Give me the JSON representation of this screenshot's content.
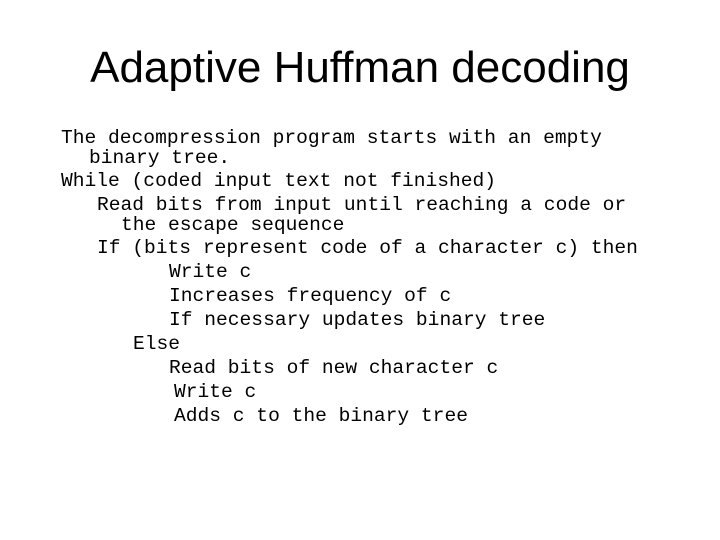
{
  "slide": {
    "title": "Adaptive Huffman decoding",
    "body_lines": [
      "The decompression program starts with an empty",
      "binary tree.",
      "While (coded input text not finished)",
      "Read bits from input until reaching a code or",
      "the escape sequence",
      "If (bits represent code of a character c) then",
      "Write c",
      "Increases frequency of c",
      "If necessary updates binary tree",
      "Else",
      "Read bits of new character c",
      "Write c",
      "Adds c to the binary tree"
    ]
  }
}
